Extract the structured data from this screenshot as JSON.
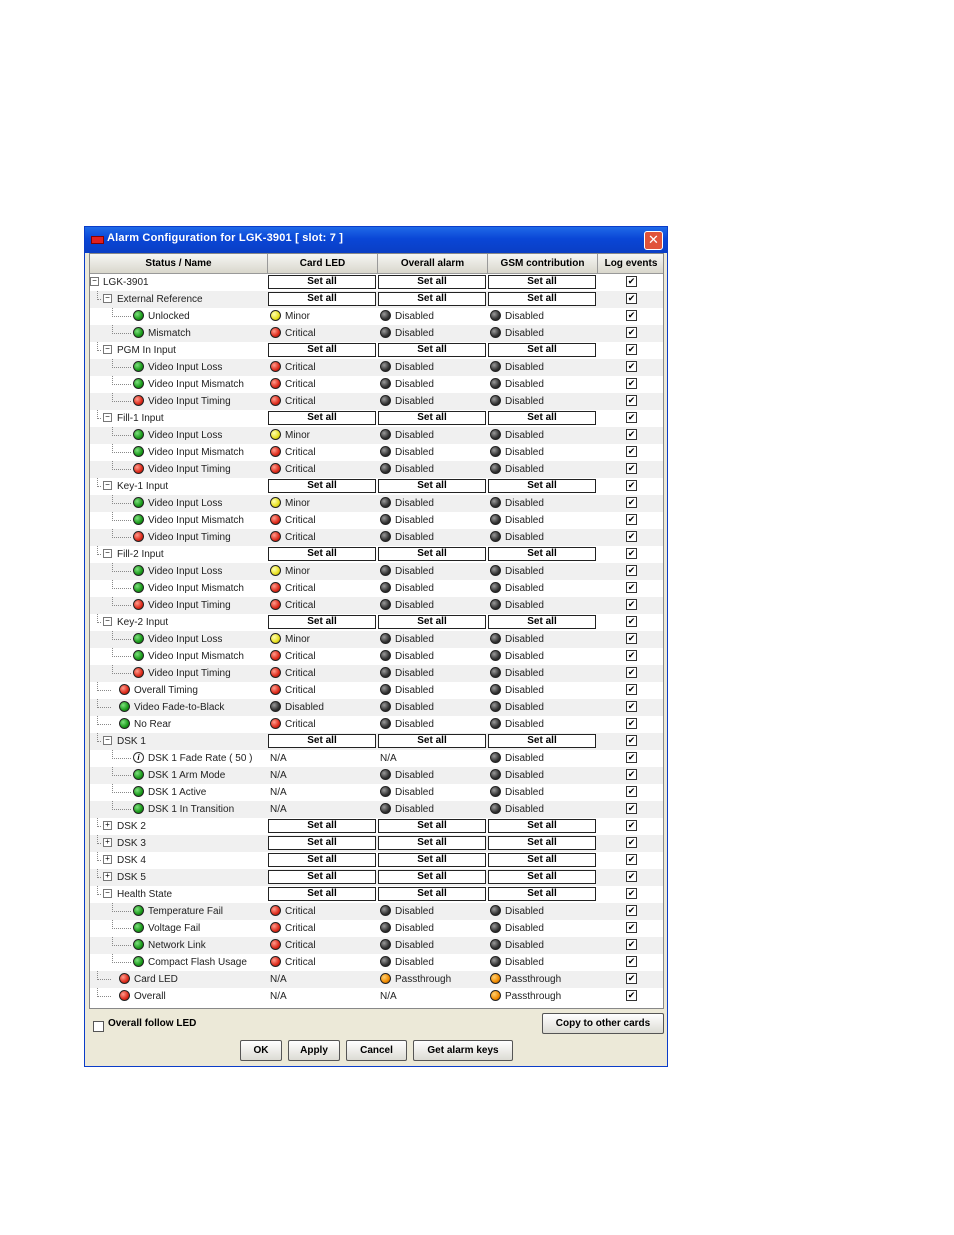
{
  "window": {
    "title": "Alarm Configuration for LGK-3901 [ slot: 7 ]",
    "close_glyph": "✕"
  },
  "columns": {
    "status": "Status / Name",
    "card_led": "Card LED",
    "overall": "Overall alarm",
    "gsm": "GSM contribution",
    "log": "Log events"
  },
  "set_all_label": "Set all",
  "check_glyph": "✔",
  "rows": [
    {
      "name": "LGK-3901",
      "level": 0,
      "node": "expanded",
      "type": "group"
    },
    {
      "name": "External Reference",
      "level": 1,
      "node": "expanded",
      "type": "group"
    },
    {
      "name": "Unlocked",
      "level": 2,
      "icon": "green",
      "led": [
        "yellow",
        "Minor"
      ],
      "ov": [
        "gray",
        "Disabled"
      ],
      "gsm": [
        "gray",
        "Disabled"
      ]
    },
    {
      "name": "Mismatch",
      "level": 2,
      "icon": "green",
      "led": [
        "red",
        "Critical"
      ],
      "ov": [
        "gray",
        "Disabled"
      ],
      "gsm": [
        "gray",
        "Disabled"
      ]
    },
    {
      "name": "PGM In Input",
      "level": 1,
      "node": "expanded",
      "type": "group"
    },
    {
      "name": "Video Input Loss",
      "level": 2,
      "icon": "green",
      "led": [
        "red",
        "Critical"
      ],
      "ov": [
        "gray",
        "Disabled"
      ],
      "gsm": [
        "gray",
        "Disabled"
      ]
    },
    {
      "name": "Video Input Mismatch",
      "level": 2,
      "icon": "green",
      "led": [
        "red",
        "Critical"
      ],
      "ov": [
        "gray",
        "Disabled"
      ],
      "gsm": [
        "gray",
        "Disabled"
      ]
    },
    {
      "name": "Video Input Timing",
      "level": 2,
      "icon": "red",
      "led": [
        "red",
        "Critical"
      ],
      "ov": [
        "gray",
        "Disabled"
      ],
      "gsm": [
        "gray",
        "Disabled"
      ]
    },
    {
      "name": "Fill-1 Input",
      "level": 1,
      "node": "expanded",
      "type": "group"
    },
    {
      "name": "Video Input Loss",
      "level": 2,
      "icon": "green",
      "led": [
        "yellow",
        "Minor"
      ],
      "ov": [
        "gray",
        "Disabled"
      ],
      "gsm": [
        "gray",
        "Disabled"
      ]
    },
    {
      "name": "Video Input Mismatch",
      "level": 2,
      "icon": "green",
      "led": [
        "red",
        "Critical"
      ],
      "ov": [
        "gray",
        "Disabled"
      ],
      "gsm": [
        "gray",
        "Disabled"
      ]
    },
    {
      "name": "Video Input Timing",
      "level": 2,
      "icon": "red",
      "led": [
        "red",
        "Critical"
      ],
      "ov": [
        "gray",
        "Disabled"
      ],
      "gsm": [
        "gray",
        "Disabled"
      ]
    },
    {
      "name": "Key-1 Input",
      "level": 1,
      "node": "expanded",
      "type": "group"
    },
    {
      "name": "Video Input Loss",
      "level": 2,
      "icon": "green",
      "led": [
        "yellow",
        "Minor"
      ],
      "ov": [
        "gray",
        "Disabled"
      ],
      "gsm": [
        "gray",
        "Disabled"
      ]
    },
    {
      "name": "Video Input Mismatch",
      "level": 2,
      "icon": "green",
      "led": [
        "red",
        "Critical"
      ],
      "ov": [
        "gray",
        "Disabled"
      ],
      "gsm": [
        "gray",
        "Disabled"
      ]
    },
    {
      "name": "Video Input Timing",
      "level": 2,
      "icon": "red",
      "led": [
        "red",
        "Critical"
      ],
      "ov": [
        "gray",
        "Disabled"
      ],
      "gsm": [
        "gray",
        "Disabled"
      ]
    },
    {
      "name": "Fill-2 Input",
      "level": 1,
      "node": "expanded",
      "type": "group"
    },
    {
      "name": "Video Input Loss",
      "level": 2,
      "icon": "green",
      "led": [
        "yellow",
        "Minor"
      ],
      "ov": [
        "gray",
        "Disabled"
      ],
      "gsm": [
        "gray",
        "Disabled"
      ]
    },
    {
      "name": "Video Input Mismatch",
      "level": 2,
      "icon": "green",
      "led": [
        "red",
        "Critical"
      ],
      "ov": [
        "gray",
        "Disabled"
      ],
      "gsm": [
        "gray",
        "Disabled"
      ]
    },
    {
      "name": "Video Input Timing",
      "level": 2,
      "icon": "red",
      "led": [
        "red",
        "Critical"
      ],
      "ov": [
        "gray",
        "Disabled"
      ],
      "gsm": [
        "gray",
        "Disabled"
      ]
    },
    {
      "name": "Key-2 Input",
      "level": 1,
      "node": "expanded",
      "type": "group"
    },
    {
      "name": "Video Input Loss",
      "level": 2,
      "icon": "green",
      "led": [
        "yellow",
        "Minor"
      ],
      "ov": [
        "gray",
        "Disabled"
      ],
      "gsm": [
        "gray",
        "Disabled"
      ]
    },
    {
      "name": "Video Input Mismatch",
      "level": 2,
      "icon": "green",
      "led": [
        "red",
        "Critical"
      ],
      "ov": [
        "gray",
        "Disabled"
      ],
      "gsm": [
        "gray",
        "Disabled"
      ]
    },
    {
      "name": "Video Input Timing",
      "level": 2,
      "icon": "red",
      "led": [
        "red",
        "Critical"
      ],
      "ov": [
        "gray",
        "Disabled"
      ],
      "gsm": [
        "gray",
        "Disabled"
      ]
    },
    {
      "name": "Overall Timing",
      "level": 1,
      "icon": "red",
      "led": [
        "red",
        "Critical"
      ],
      "ov": [
        "gray",
        "Disabled"
      ],
      "gsm": [
        "gray",
        "Disabled"
      ]
    },
    {
      "name": "Video Fade-to-Black",
      "level": 1,
      "icon": "green",
      "led": [
        "gray",
        "Disabled"
      ],
      "ov": [
        "gray",
        "Disabled"
      ],
      "gsm": [
        "gray",
        "Disabled"
      ]
    },
    {
      "name": "No Rear",
      "level": 1,
      "icon": "green",
      "led": [
        "red",
        "Critical"
      ],
      "ov": [
        "gray",
        "Disabled"
      ],
      "gsm": [
        "gray",
        "Disabled"
      ]
    },
    {
      "name": "DSK 1",
      "level": 1,
      "node": "expanded",
      "type": "group"
    },
    {
      "name": "DSK 1 Fade Rate ( 50 )",
      "level": 2,
      "icon": "info",
      "led": [
        "",
        "N/A"
      ],
      "ov": [
        "",
        "N/A"
      ],
      "gsm": [
        "gray",
        "Disabled"
      ]
    },
    {
      "name": "DSK 1 Arm Mode",
      "level": 2,
      "icon": "green",
      "led": [
        "",
        "N/A"
      ],
      "ov": [
        "gray",
        "Disabled"
      ],
      "gsm": [
        "gray",
        "Disabled"
      ]
    },
    {
      "name": "DSK 1 Active",
      "level": 2,
      "icon": "green",
      "led": [
        "",
        "N/A"
      ],
      "ov": [
        "gray",
        "Disabled"
      ],
      "gsm": [
        "gray",
        "Disabled"
      ]
    },
    {
      "name": "DSK 1 In Transition",
      "level": 2,
      "icon": "green",
      "led": [
        "",
        "N/A"
      ],
      "ov": [
        "gray",
        "Disabled"
      ],
      "gsm": [
        "gray",
        "Disabled"
      ]
    },
    {
      "name": "DSK 2",
      "level": 1,
      "node": "collapsed",
      "type": "group"
    },
    {
      "name": "DSK 3",
      "level": 1,
      "node": "collapsed",
      "type": "group"
    },
    {
      "name": "DSK 4",
      "level": 1,
      "node": "collapsed",
      "type": "group"
    },
    {
      "name": "DSK 5",
      "level": 1,
      "node": "collapsed",
      "type": "group"
    },
    {
      "name": "Health State",
      "level": 1,
      "node": "expanded",
      "type": "group"
    },
    {
      "name": "Temperature Fail",
      "level": 2,
      "icon": "green",
      "led": [
        "red",
        "Critical"
      ],
      "ov": [
        "gray",
        "Disabled"
      ],
      "gsm": [
        "gray",
        "Disabled"
      ]
    },
    {
      "name": "Voltage Fail",
      "level": 2,
      "icon": "green",
      "led": [
        "red",
        "Critical"
      ],
      "ov": [
        "gray",
        "Disabled"
      ],
      "gsm": [
        "gray",
        "Disabled"
      ]
    },
    {
      "name": "Network Link",
      "level": 2,
      "icon": "green",
      "led": [
        "red",
        "Critical"
      ],
      "ov": [
        "gray",
        "Disabled"
      ],
      "gsm": [
        "gray",
        "Disabled"
      ]
    },
    {
      "name": "Compact Flash Usage",
      "level": 2,
      "icon": "green",
      "led": [
        "red",
        "Critical"
      ],
      "ov": [
        "gray",
        "Disabled"
      ],
      "gsm": [
        "gray",
        "Disabled"
      ]
    },
    {
      "name": "Card LED",
      "level": 1,
      "icon": "red",
      "led": [
        "",
        "N/A"
      ],
      "ov": [
        "orange",
        "Passthrough"
      ],
      "gsm": [
        "orange",
        "Passthrough"
      ]
    },
    {
      "name": "Overall",
      "level": 1,
      "icon": "red",
      "led": [
        "",
        "N/A"
      ],
      "ov": [
        "",
        "N/A"
      ],
      "gsm": [
        "orange",
        "Passthrough"
      ]
    }
  ],
  "footer": {
    "overall_follow_led": "Overall follow LED",
    "copy_button": "Copy to other cards",
    "ok": "OK",
    "apply": "Apply",
    "cancel": "Cancel",
    "get_keys": "Get alarm keys"
  }
}
